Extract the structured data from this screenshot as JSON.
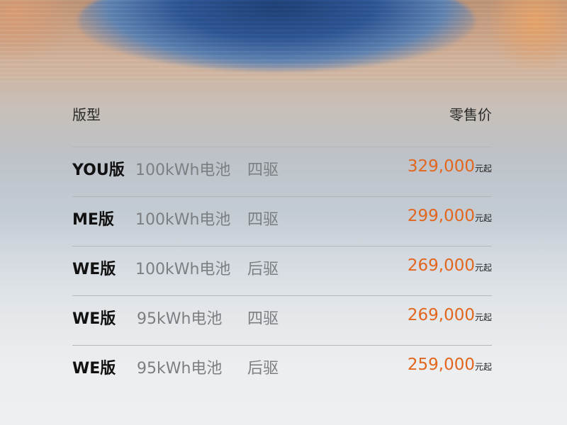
{
  "header": {
    "model_label": "版型",
    "price_label": "零售价"
  },
  "colors": {
    "price": "#e2661d",
    "version": "#111111",
    "spec": "#7c7f82"
  },
  "rows": [
    {
      "version": "YOU版",
      "battery": "100kWh电池",
      "drive": "四驱",
      "price": "329,000",
      "unit": "元起"
    },
    {
      "version": "ME版",
      "battery": "100kWh电池",
      "drive": "四驱",
      "price": "299,000",
      "unit": "元起"
    },
    {
      "version": "WE版",
      "battery": "100kWh电池",
      "drive": "后驱",
      "price": "269,000",
      "unit": "元起"
    },
    {
      "version": "WE版",
      "battery": "95kWh电池",
      "drive": "四驱",
      "price": "269,000",
      "unit": "元起"
    },
    {
      "version": "WE版",
      "battery": "95kWh电池",
      "drive": "后驱",
      "price": "259,000",
      "unit": "元起"
    }
  ]
}
